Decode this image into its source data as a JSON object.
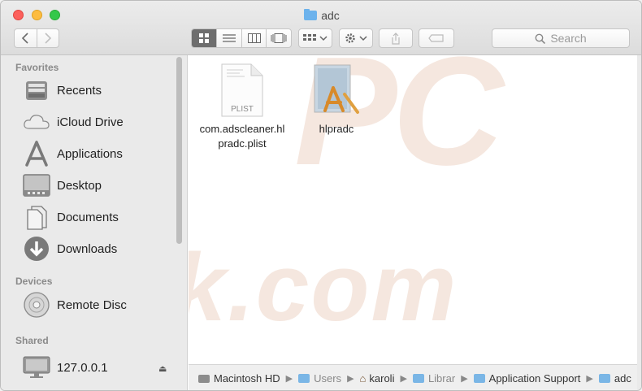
{
  "window": {
    "title": "adc"
  },
  "toolbar": {
    "back_icon": "chevron-left-icon",
    "forward_icon": "chevron-right-icon",
    "search_placeholder": "Search"
  },
  "sidebar": {
    "favorites_header": "Favorites",
    "favorites": [
      {
        "label": "Recents",
        "icon": "recents-icon"
      },
      {
        "label": "iCloud Drive",
        "icon": "cloud-icon"
      },
      {
        "label": "Applications",
        "icon": "applications-icon"
      },
      {
        "label": "Desktop",
        "icon": "desktop-icon"
      },
      {
        "label": "Documents",
        "icon": "document-icon"
      },
      {
        "label": "Downloads",
        "icon": "download-icon"
      }
    ],
    "devices_header": "Devices",
    "devices": [
      {
        "label": "Remote Disc",
        "icon": "disc-icon"
      }
    ],
    "shared_header": "Shared",
    "shared": [
      {
        "label": "127.0.0.1",
        "icon": "monitor-icon"
      }
    ]
  },
  "content": {
    "files": [
      {
        "name_line1": "com.adscleaner.hl",
        "name_line2": "pradc.plist",
        "badge": "PLIST",
        "icon": "plist-file-icon"
      },
      {
        "name_line1": "hlpradc",
        "icon": "app-file-icon"
      }
    ],
    "watermark_top": "PC",
    "watermark_bottom": "risk.com"
  },
  "pathbar": {
    "items": [
      "Macintosh HD",
      "Users",
      "karoli",
      "Librar",
      "Application Support",
      "adc"
    ]
  },
  "colors": {
    "folder_blue": "#6cb2ec",
    "close": "#fc605c",
    "minimize": "#fdbc40",
    "maximize": "#34c84a"
  }
}
